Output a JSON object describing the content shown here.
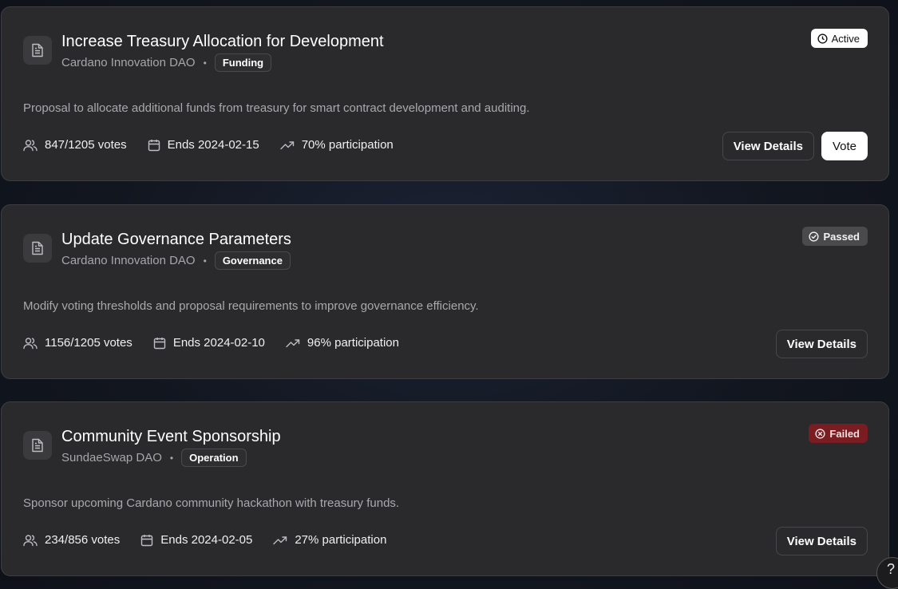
{
  "proposals": [
    {
      "title": "Increase Treasury Allocation for Development",
      "dao": "Cardano Innovation DAO",
      "category": "Funding",
      "status": "Active",
      "description": "Proposal to allocate additional funds from treasury for smart contract development and auditing.",
      "votes": "847/1205 votes",
      "ends": "Ends 2024-02-15",
      "participation": "70% participation",
      "view_label": "View Details",
      "vote_label": "Vote"
    },
    {
      "title": "Update Governance Parameters",
      "dao": "Cardano Innovation DAO",
      "category": "Governance",
      "status": "Passed",
      "description": "Modify voting thresholds and proposal requirements to improve governance efficiency.",
      "votes": "1156/1205 votes",
      "ends": "Ends 2024-02-10",
      "participation": "96% participation",
      "view_label": "View Details"
    },
    {
      "title": "Community Event Sponsorship",
      "dao": "SundaeSwap DAO",
      "category": "Operation",
      "status": "Failed",
      "description": "Sponsor upcoming Cardano community hackathon with treasury funds.",
      "votes": "234/856 votes",
      "ends": "Ends 2024-02-05",
      "participation": "27% participation",
      "view_label": "View Details"
    }
  ],
  "help": {
    "label": "?"
  },
  "icons": {
    "document": "document-icon",
    "users": "users-icon",
    "calendar": "calendar-icon",
    "trend": "trending-up-icon",
    "clock": "clock-icon",
    "check": "check-circle-icon",
    "x": "x-circle-icon"
  },
  "colors": {
    "card_bg": "#2a2a2c",
    "status_active_bg": "#ffffff",
    "status_passed_bg": "#4a4a4d",
    "status_failed_bg": "#7a1d22"
  }
}
